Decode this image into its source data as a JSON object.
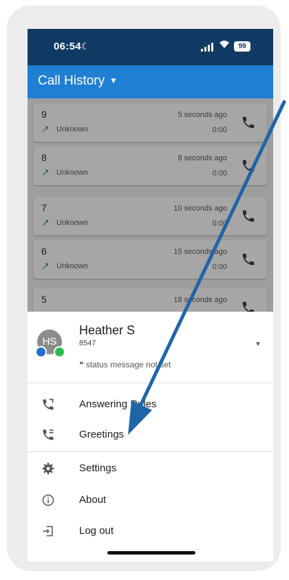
{
  "status_bar": {
    "time": "06:54",
    "battery": "99"
  },
  "app_bar": {
    "title": "Call History"
  },
  "calls": [
    {
      "name": "9",
      "type": "Unknown",
      "time": "5 seconds ago",
      "duration": "0:00"
    },
    {
      "name": "8",
      "type": "Unknown",
      "time": "8 seconds ago",
      "duration": "0:00"
    },
    {
      "name": "7",
      "type": "Unknown",
      "time": "10 seconds ago",
      "duration": "0:00"
    },
    {
      "name": "6",
      "type": "Unknown",
      "time": "15 seconds ago",
      "duration": "0:00"
    },
    {
      "name": "5",
      "type": "",
      "time": "18 seconds ago",
      "duration": ""
    }
  ],
  "user": {
    "initials": "HS",
    "name": "Heather S",
    "extension": "8547",
    "status": "❝ status message not set"
  },
  "menu": {
    "answering_rules": "Answering Rules",
    "greetings": "Greetings",
    "settings": "Settings",
    "about": "About",
    "logout": "Log out"
  },
  "colors": {
    "status_bar": "#103a63",
    "app_bar": "#1f7fd3",
    "annotation_arrow": "#1f64a8"
  }
}
